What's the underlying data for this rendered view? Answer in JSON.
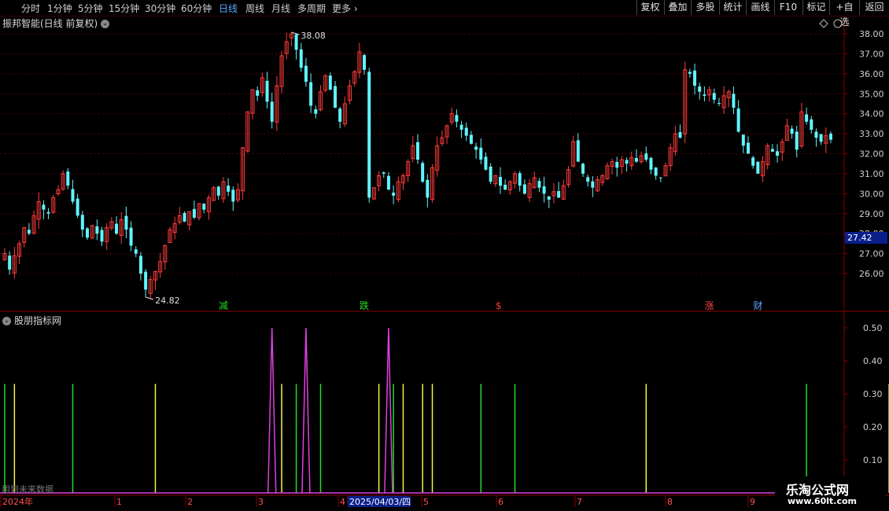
{
  "toolbar": {
    "periods": [
      "分时",
      "1分钟",
      "5分钟",
      "15分钟",
      "30分钟",
      "60分钟",
      "日线",
      "周线",
      "月线",
      "多周期",
      "更多"
    ],
    "active_period": "日线",
    "right_buttons": [
      "复权",
      "叠加",
      "多股",
      "统计",
      "画线",
      "F10",
      "标记",
      "+自选",
      "返回"
    ]
  },
  "main_panel": {
    "title": "振邦智能(日线 前复权)",
    "current_price_tag": "27.42",
    "high_label": "38.08",
    "low_label": "24.82",
    "markers": [
      {
        "text": "减",
        "color": "#22dd22",
        "x_index": 45
      },
      {
        "text": "跌",
        "color": "#22dd22",
        "x_index": 74
      },
      {
        "text": "$",
        "color": "#ff3333",
        "x_index": 102
      },
      {
        "text": "涨",
        "color": "#ff4444",
        "x_index": 145
      },
      {
        "text": "财",
        "color": "#5aa7ff",
        "x_index": 155
      }
    ]
  },
  "indicator_panel": {
    "title": "股朋指标网",
    "future_data_note": "用到未来数据"
  },
  "x_axis": {
    "labels": [
      "2024年",
      "1",
      "2",
      "3",
      "4",
      "2025/04/03/四",
      "5",
      "6",
      "7",
      "8",
      "9"
    ]
  },
  "watermark": {
    "main": "乐淘公式网",
    "sub": "www.60lt.com"
  },
  "chart_data": [
    {
      "type": "candlestick",
      "title": "振邦智能(日线 前复权)",
      "y_ticks": [
        26.0,
        27.0,
        28.0,
        29.0,
        30.0,
        31.0,
        32.0,
        33.0,
        34.0,
        35.0,
        36.0,
        37.0,
        38.0
      ],
      "ylim": [
        24.2,
        38.6
      ],
      "up_color": "#ff3b3b",
      "down_color": "#5ff5ff",
      "closes": [
        27.0,
        26.2,
        26.9,
        27.5,
        28.3,
        28.0,
        28.9,
        29.6,
        29.2,
        29.0,
        29.8,
        30.2,
        31.0,
        30.4,
        29.6,
        28.9,
        28.2,
        27.8,
        28.4,
        28.0,
        27.6,
        28.3,
        28.6,
        28.0,
        28.7,
        28.2,
        27.4,
        27.0,
        26.0,
        25.2,
        25.7,
        26.1,
        26.6,
        27.4,
        28.2,
        28.5,
        28.9,
        28.6,
        29.1,
        28.8,
        29.5,
        29.2,
        29.8,
        30.3,
        29.9,
        30.6,
        30.1,
        29.6,
        30.2,
        32.3,
        34.1,
        35.2,
        34.9,
        35.8,
        34.6,
        33.6,
        35.4,
        36.9,
        37.6,
        38.0,
        37.2,
        36.3,
        35.6,
        34.4,
        34.0,
        35.1,
        35.9,
        35.2,
        34.3,
        33.6,
        34.5,
        35.4,
        36.1,
        37.1,
        36.2,
        29.8,
        30.3,
        30.9,
        31.0,
        30.2,
        29.9,
        30.6,
        30.9,
        31.6,
        32.4,
        31.7,
        30.6,
        29.8,
        31.3,
        32.4,
        32.8,
        33.4,
        34.0,
        33.6,
        33.2,
        32.9,
        32.5,
        32.2,
        31.7,
        31.2,
        30.6,
        30.9,
        30.4,
        30.2,
        30.6,
        31.0,
        30.4,
        30.0,
        30.5,
        30.8,
        30.3,
        30.0,
        29.7,
        30.1,
        29.8,
        30.4,
        31.2,
        32.6,
        31.6,
        31.0,
        30.6,
        30.3,
        30.7,
        30.9,
        31.4,
        31.6,
        31.3,
        31.7,
        31.5,
        31.8,
        31.6,
        31.9,
        31.7,
        31.2,
        30.9,
        30.8,
        31.4,
        32.3,
        33.0,
        32.8,
        36.2,
        36.0,
        35.4,
        35.1,
        34.9,
        35.2,
        34.7,
        34.5,
        34.9,
        35.1,
        34.3,
        33.1,
        32.4,
        32.0,
        31.4,
        31.0,
        31.6,
        32.4,
        32.1,
        31.9,
        32.6,
        33.4,
        33.0,
        32.2,
        34.1,
        33.6,
        33.2,
        32.8,
        32.6,
        32.9,
        32.7
      ],
      "high": 38.08,
      "low": 24.82
    },
    {
      "type": "bar",
      "title": "股朋指标网",
      "y_ticks": [
        0.1,
        0.2,
        0.3,
        0.4,
        0.5
      ],
      "ylim": [
        0,
        0.55
      ],
      "yellow_lines_at": [
        2,
        31,
        57,
        77,
        86,
        88,
        82,
        132,
        182,
        194
      ],
      "green_lines_at": [
        0,
        14,
        60,
        65,
        80,
        98,
        105,
        165,
        190
      ],
      "magenta_peaks_at": [
        55,
        62,
        79
      ],
      "line_height": 0.33,
      "peak_height": 0.5
    }
  ]
}
